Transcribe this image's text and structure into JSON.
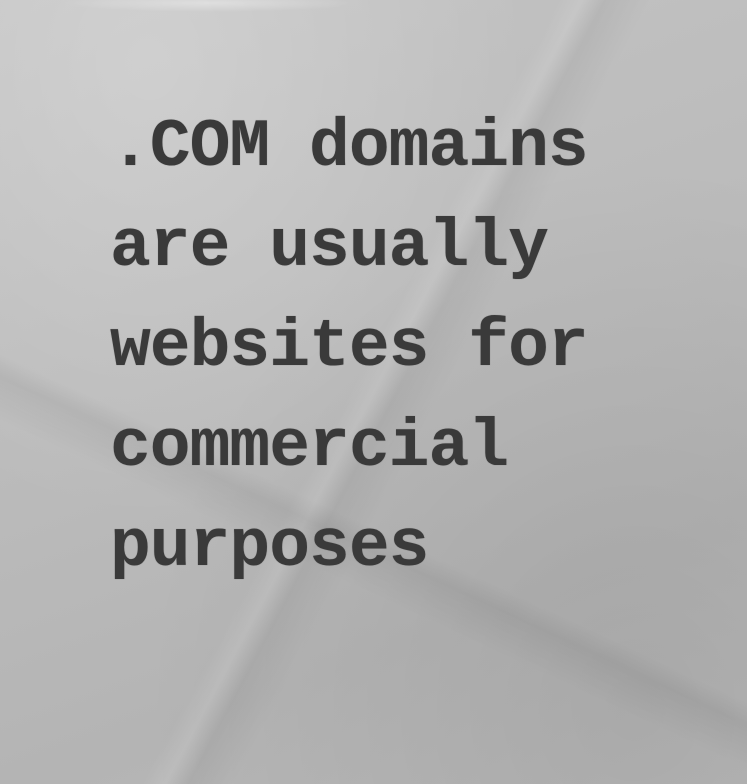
{
  "message": {
    "lines": [
      ".COM domains",
      "are usually",
      "websites for",
      "commercial",
      "purposes"
    ]
  },
  "colors": {
    "text": "#3a3a3a",
    "background": "#bdbdbd"
  }
}
